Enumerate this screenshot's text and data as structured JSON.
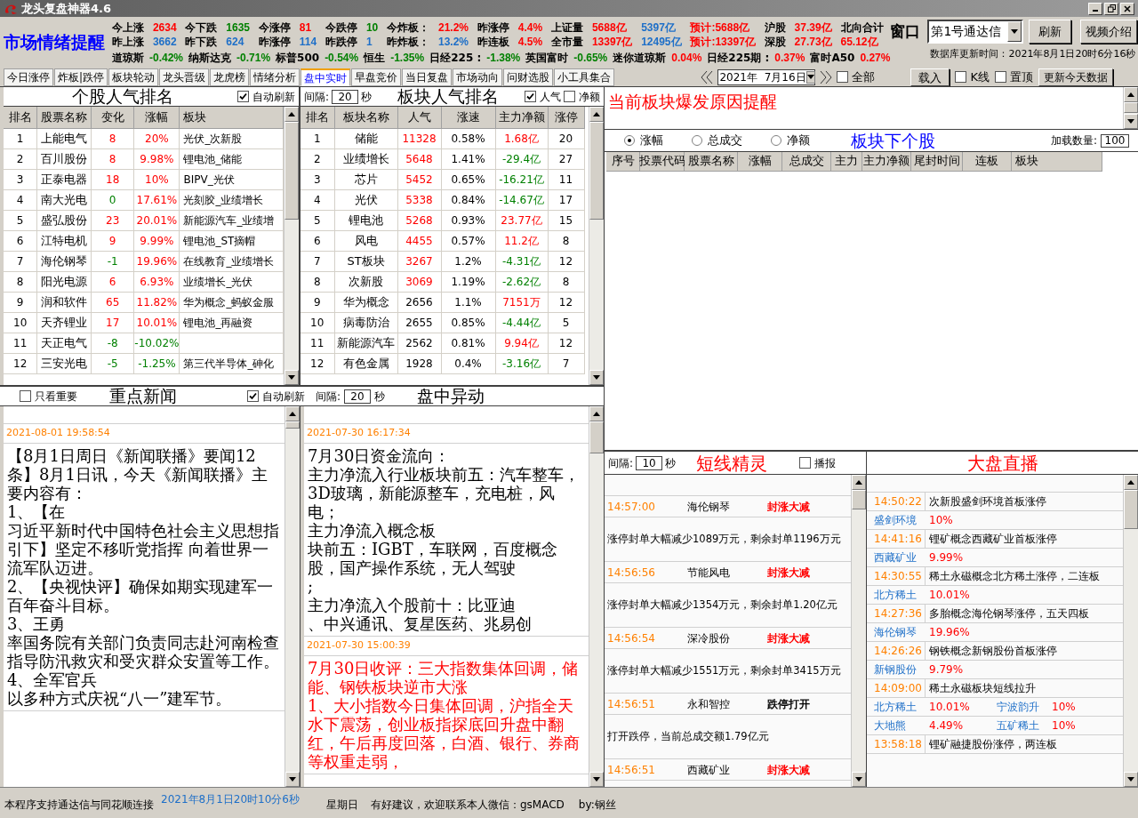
{
  "window": {
    "title": "龙头复盘神器4.6"
  },
  "header": {
    "title": "市场情绪提醒",
    "stat_rows": [
      [
        {
          "kind": "label",
          "text": "今上涨"
        },
        {
          "kind": "value",
          "text": "2634",
          "color": "#ff0000"
        },
        {
          "kind": "label",
          "text": "今下跌"
        },
        {
          "kind": "value",
          "text": "1635",
          "color": "#008000"
        },
        {
          "kind": "label",
          "text": "今涨停"
        },
        {
          "kind": "value",
          "text": "81",
          "color": "#ff0000"
        },
        {
          "kind": "label",
          "text": "今跌停"
        },
        {
          "kind": "value",
          "text": "10",
          "color": "#008000"
        },
        {
          "kind": "label",
          "text": "今炸板："
        },
        {
          "kind": "value",
          "text": "21.2%",
          "color": "#ff0000"
        },
        {
          "kind": "label",
          "text": "昨涨停"
        },
        {
          "kind": "value",
          "text": "4.4%",
          "color": "#ff0000"
        },
        {
          "kind": "label",
          "text": "上证量"
        },
        {
          "kind": "value",
          "text": "5688亿",
          "color": "#ff0000"
        },
        {
          "kind": "value",
          "text": "5397亿",
          "color": "#1e6fc8"
        },
        {
          "kind": "value",
          "text": "预计:5688亿",
          "color": "#ff0000"
        },
        {
          "kind": "label",
          "text": "沪股"
        },
        {
          "kind": "value",
          "text": "37.39亿",
          "color": "#ff0000"
        },
        {
          "kind": "label",
          "text": "北向合计"
        }
      ],
      [
        {
          "kind": "label",
          "text": "昨上涨"
        },
        {
          "kind": "value",
          "text": "3662",
          "color": "#1e6fc8"
        },
        {
          "kind": "label",
          "text": "昨下跌"
        },
        {
          "kind": "value",
          "text": "624",
          "color": "#1e6fc8"
        },
        {
          "kind": "label",
          "text": "昨涨停"
        },
        {
          "kind": "value",
          "text": "114",
          "color": "#1e6fc8"
        },
        {
          "kind": "label",
          "text": "昨跌停"
        },
        {
          "kind": "value",
          "text": "1",
          "color": "#1e6fc8"
        },
        {
          "kind": "label",
          "text": "昨炸板："
        },
        {
          "kind": "value",
          "text": "13.2%",
          "color": "#1e6fc8"
        },
        {
          "kind": "label",
          "text": "昨连板"
        },
        {
          "kind": "value",
          "text": "4.5%",
          "color": "#ff0000"
        },
        {
          "kind": "label",
          "text": "全市量"
        },
        {
          "kind": "value",
          "text": "13397亿",
          "color": "#ff0000"
        },
        {
          "kind": "value",
          "text": "12495亿",
          "color": "#1e6fc8"
        },
        {
          "kind": "value",
          "text": "预计:13397亿",
          "color": "#ff0000"
        },
        {
          "kind": "label",
          "text": "深股"
        },
        {
          "kind": "value",
          "text": "27.73亿",
          "color": "#ff0000"
        },
        {
          "kind": "value",
          "text": "65.12亿",
          "color": "#ff0000"
        }
      ]
    ],
    "indices": [
      {
        "kind": "label",
        "text": "道琼斯"
      },
      {
        "kind": "value",
        "text": "-0.42%",
        "color": "#008000"
      },
      {
        "kind": "label",
        "text": "纳斯达克"
      },
      {
        "kind": "value",
        "text": "-0.71%",
        "color": "#008000"
      },
      {
        "kind": "label",
        "text": "标普500"
      },
      {
        "kind": "value",
        "text": "-0.54%",
        "color": "#008000"
      },
      {
        "kind": "label",
        "text": "恒生"
      },
      {
        "kind": "value",
        "text": "-1.35%",
        "color": "#008000"
      },
      {
        "kind": "label",
        "text": "日经225 :"
      },
      {
        "kind": "value",
        "text": "-1.38%",
        "color": "#008000"
      },
      {
        "kind": "label",
        "text": "英国富时"
      },
      {
        "kind": "value",
        "text": "-0.65%",
        "color": "#008000"
      },
      {
        "kind": "label",
        "text": "迷你道琼斯"
      },
      {
        "kind": "value",
        "text": "0.04%",
        "color": "#ff0000"
      },
      {
        "kind": "label",
        "text": "日经225期 :"
      },
      {
        "kind": "value",
        "text": "0.37%",
        "color": "#ff0000"
      },
      {
        "kind": "label",
        "text": "富时A50"
      },
      {
        "kind": "value",
        "text": "0.27%",
        "color": "#ff0000"
      }
    ],
    "window_label": "窗口",
    "window_select": "第1号通达信",
    "buttons": [
      "刷新",
      "视频介绍"
    ],
    "db_time": "数据库更新时间：2021年8月1日20时6分16秒"
  },
  "tabs": [
    {
      "label": "今日涨停",
      "selected": false
    },
    {
      "label": "炸板|跌停",
      "selected": false
    },
    {
      "label": "板块轮动",
      "selected": false
    },
    {
      "label": "龙头晋级",
      "selected": false
    },
    {
      "label": "龙虎榜",
      "selected": false
    },
    {
      "label": "情绪分析",
      "selected": false
    },
    {
      "label": "盘中实时",
      "selected": true
    },
    {
      "label": "早盘竞价",
      "selected": false
    },
    {
      "label": "当日复盘",
      "selected": false
    },
    {
      "label": "市场动向",
      "selected": false
    },
    {
      "label": "问财选股",
      "selected": false
    },
    {
      "label": "小工具集合",
      "selected": false
    }
  ],
  "toolbar": {
    "date": "2021年  7月16日",
    "all": {
      "label": "全部",
      "checked": false
    },
    "load": "载入",
    "kline": {
      "label": "K线",
      "checked": false
    },
    "pin": {
      "label": "置顶",
      "checked": false
    },
    "update": "更新今天数据"
  },
  "stock_rank": {
    "title": "个股人气排名",
    "auto_refresh": {
      "label": "自动刷新",
      "checked": true
    },
    "columns": [
      "排名",
      "股票名称",
      "变化",
      "涨幅",
      "板块"
    ],
    "rows": [
      {
        "rank": "1",
        "name": "上能电气",
        "change": {
          "text": "8",
          "color": "#ff0000"
        },
        "pct": {
          "text": "20%",
          "color": "#ff0000"
        },
        "sector": "光伏_次新股"
      },
      {
        "rank": "2",
        "name": "百川股份",
        "change": {
          "text": "8",
          "color": "#ff0000"
        },
        "pct": {
          "text": "9.98%",
          "color": "#ff0000"
        },
        "sector": "锂电池_储能"
      },
      {
        "rank": "3",
        "name": "正泰电器",
        "change": {
          "text": "18",
          "color": "#ff0000"
        },
        "pct": {
          "text": "10%",
          "color": "#ff0000"
        },
        "sector": "BIPV_光伏"
      },
      {
        "rank": "4",
        "name": "南大光电",
        "change": {
          "text": "0",
          "color": "#008000"
        },
        "pct": {
          "text": "17.61%",
          "color": "#ff0000"
        },
        "sector": "光刻胶_业绩增长"
      },
      {
        "rank": "5",
        "name": "盛弘股份",
        "change": {
          "text": "23",
          "color": "#ff0000"
        },
        "pct": {
          "text": "20.01%",
          "color": "#ff0000"
        },
        "sector": "新能源汽车_业绩增"
      },
      {
        "rank": "6",
        "name": "江特电机",
        "change": {
          "text": "9",
          "color": "#ff0000"
        },
        "pct": {
          "text": "9.99%",
          "color": "#ff0000"
        },
        "sector": "锂电池_ST摘帽"
      },
      {
        "rank": "7",
        "name": "海伦钢琴",
        "change": {
          "text": "-1",
          "color": "#008000"
        },
        "pct": {
          "text": "19.96%",
          "color": "#ff0000"
        },
        "sector": "在线教育_业绩增长"
      },
      {
        "rank": "8",
        "name": "阳光电源",
        "change": {
          "text": "6",
          "color": "#ff0000"
        },
        "pct": {
          "text": "6.93%",
          "color": "#ff0000"
        },
        "sector": "业绩增长_光伏"
      },
      {
        "rank": "9",
        "name": "润和软件",
        "change": {
          "text": "65",
          "color": "#ff0000"
        },
        "pct": {
          "text": "11.82%",
          "color": "#ff0000"
        },
        "sector": "华为概念_蚂蚁金服"
      },
      {
        "rank": "10",
        "name": "天齐锂业",
        "change": {
          "text": "17",
          "color": "#ff0000"
        },
        "pct": {
          "text": "10.01%",
          "color": "#ff0000"
        },
        "sector": "锂电池_再融资"
      },
      {
        "rank": "11",
        "name": "天正电气",
        "change": {
          "text": "-8",
          "color": "#008000"
        },
        "pct": {
          "text": "-10.02%",
          "color": "#008000"
        }
      },
      {
        "rank": "12",
        "name": "三安光电",
        "change": {
          "text": "-5",
          "color": "#008000"
        },
        "pct": {
          "text": "-1.25%",
          "color": "#008000"
        },
        "sector": "第三代半导体_砷化"
      }
    ]
  },
  "sector_rank": {
    "interval_label": "间隔:",
    "interval": "20",
    "unit": "秒",
    "title": "板块人气排名",
    "popularity": {
      "label": "人气",
      "checked": true
    },
    "net": {
      "label": "净额",
      "checked": false
    },
    "columns": [
      "排名",
      "板块名称",
      "人气",
      "涨速",
      "主力净额",
      "涨停"
    ],
    "rows": [
      {
        "rank": "1",
        "name": "储能",
        "pop": {
          "text": "11328",
          "color": "#ff0000"
        },
        "speed": "0.58%",
        "net": {
          "text": "1.68亿",
          "color": "#ff0000"
        },
        "limit": "20"
      },
      {
        "rank": "2",
        "name": "业绩增长",
        "pop": {
          "text": "5648",
          "color": "#ff0000"
        },
        "speed": "1.41%",
        "net": {
          "text": "-29.4亿",
          "color": "#008000"
        },
        "limit": "27"
      },
      {
        "rank": "3",
        "name": "芯片",
        "pop": {
          "text": "5452",
          "color": "#ff0000"
        },
        "speed": "0.65%",
        "net": {
          "text": "-16.21亿",
          "color": "#008000"
        },
        "limit": "11"
      },
      {
        "rank": "4",
        "name": "光伏",
        "pop": {
          "text": "5338",
          "color": "#ff0000"
        },
        "speed": "0.84%",
        "net": {
          "text": "-14.67亿",
          "color": "#008000"
        },
        "limit": "17"
      },
      {
        "rank": "5",
        "name": "锂电池",
        "pop": {
          "text": "5268",
          "color": "#ff0000"
        },
        "speed": "0.93%",
        "net": {
          "text": "23.77亿",
          "color": "#ff0000"
        },
        "limit": "15"
      },
      {
        "rank": "6",
        "name": "风电",
        "pop": {
          "text": "4455",
          "color": "#ff0000"
        },
        "speed": "0.57%",
        "net": {
          "text": "11.2亿",
          "color": "#ff0000"
        },
        "limit": "8"
      },
      {
        "rank": "7",
        "name": "ST板块",
        "pop": {
          "text": "3267",
          "color": "#ff0000"
        },
        "speed": "1.2%",
        "net": {
          "text": "-4.31亿",
          "color": "#008000"
        },
        "limit": "12"
      },
      {
        "rank": "8",
        "name": "次新股",
        "pop": {
          "text": "3069",
          "color": "#ff0000"
        },
        "speed": "1.19%",
        "net": {
          "text": "-2.62亿",
          "color": "#008000"
        },
        "limit": "8"
      },
      {
        "rank": "9",
        "name": "华为概念",
        "pop": {
          "text": "2656",
          "color": "#000000"
        },
        "speed": "1.1%",
        "net": {
          "text": "7151万",
          "color": "#ff0000"
        },
        "limit": "12"
      },
      {
        "rank": "10",
        "name": "病毒防治",
        "pop": {
          "text": "2655",
          "color": "#000000"
        },
        "speed": "0.85%",
        "net": {
          "text": "-4.44亿",
          "color": "#008000"
        },
        "limit": "5"
      },
      {
        "rank": "11",
        "name": "新能源汽车",
        "pop": {
          "text": "2562",
          "color": "#000000"
        },
        "speed": "0.81%",
        "net": {
          "text": "9.94亿",
          "color": "#ff0000"
        },
        "limit": "12"
      },
      {
        "rank": "12",
        "name": "有色金属",
        "pop": {
          "text": "1928",
          "color": "#000000"
        },
        "speed": "0.4%",
        "net": {
          "text": "-3.16亿",
          "color": "#008000"
        },
        "limit": "7"
      }
    ]
  },
  "news": {
    "important_only": {
      "label": "只看重要",
      "checked": false
    },
    "title": "重点新闻",
    "auto_refresh": {
      "label": "自动刷新",
      "checked": true
    },
    "interval_label": "间隔:",
    "interval": "20",
    "unit": "秒",
    "items": [
      {
        "time": "2021-08-01 19:58:54",
        "important": false,
        "lines": [
          "【8月1日周日《新闻联播》要闻12条】8月1日讯，今天《新闻联播》主要内容有：",
          "1、【在",
          "习近平新时代中国特色社会主义思想指引下】坚定不移听党指挥 向着世界一流军队迈进。",
          "2、【央视快评】确保如期实现建军一百年奋斗目标。",
          "3、王勇",
          "率国务院有关部门负责同志赴河南检查指导防汛救灾和受灾群众安置等工作。",
          "4、全军官兵",
          "以多种方式庆祝“八一”建军节。"
        ]
      }
    ]
  },
  "moves": {
    "title": "盘中异动",
    "items": [
      {
        "time": "2021-07-30 16:17:34",
        "important": false,
        "lines": [
          "7月30日资金流向：",
          "主力净流入行业板块前五：汽车整车，3D玻璃，新能源整车，充电桩，风电；",
          "主力净流入概念板",
          "块前五：IGBT，车联网，百度概念股，国产操作系统，无人驾驶",
          ";",
          "主力净流入个股前十：比亚迪",
          "、中兴通讯、复星医药、兆易创"
        ]
      },
      {
        "time": "2021-07-30 15:00:39",
        "important": true,
        "lines": [
          "7月30日收评：三大指数集体回调，储能、钢铁板块逆市大涨",
          "1、大小指数今日集体回调，沪指全天水下震荡，创业板指探底回升盘中翻红，午后再度回落，白酒、银行、券商等权重走弱，"
        ]
      }
    ]
  },
  "sector_reason": {
    "title": "当前板块爆发原因提醒"
  },
  "sector_stocks": {
    "sort": [
      {
        "label": "涨幅",
        "selected": true
      },
      {
        "label": "总成交",
        "selected": false
      },
      {
        "label": "净额",
        "selected": false
      }
    ],
    "title": "板块下个股",
    "load_label": "加载数量:",
    "load_count": "100",
    "columns": [
      "序号",
      "投票代码",
      "股票名称",
      "涨幅",
      "总成交",
      "主力",
      "主力净额",
      "尾封时间",
      "连板",
      "板块"
    ]
  },
  "sprite": {
    "interval_label": "间隔:",
    "interval": "10",
    "unit": "秒",
    "title": "短线精灵",
    "broadcast": {
      "label": "播报",
      "checked": false
    },
    "items": [
      {
        "time": "14:57:00",
        "name": "海伦钢琴",
        "event": "封涨大减",
        "color": "#ff0000",
        "detail": "涨停封单大幅减少1089万元，剩余封单1196万元"
      },
      {
        "time": "14:56:56",
        "name": "节能风电",
        "event": "封涨大减",
        "color": "#ff0000",
        "detail": "涨停封单大幅减少1354万元，剩余封单1.20亿元"
      },
      {
        "time": "14:56:54",
        "name": "深冷股份",
        "event": "封涨大减",
        "color": "#ff0000",
        "detail": "涨停封单大幅减少1551万元，剩余封单3415万元"
      },
      {
        "time": "14:56:51",
        "name": "永和智控",
        "event": "跌停打开",
        "color": "#000000",
        "detail": "打开跌停，当前总成交额1.79亿元"
      },
      {
        "time": "14:56:51",
        "name": "西藏矿业",
        "event": "封涨大减",
        "color": "#ff0000"
      }
    ]
  },
  "live": {
    "title": "大盘直播",
    "items": [
      {
        "time": "14:50:22",
        "text": "次新股盛剑环境首板涨停",
        "stocks": [
          [
            {
              "name": "盛剑环境",
              "pct": "10%"
            }
          ]
        ]
      },
      {
        "time": "14:41:16",
        "text": "锂矿概念西藏矿业首板涨停",
        "stocks": [
          [
            {
              "name": "西藏矿业",
              "pct": "9.99%"
            }
          ]
        ]
      },
      {
        "time": "14:30:55",
        "text": "稀土永磁概念北方稀土涨停，二连板",
        "stocks": [
          [
            {
              "name": "北方稀土",
              "pct": "10.01%"
            }
          ]
        ]
      },
      {
        "time": "14:27:36",
        "text": "多胎概念海伦钢琴涨停，五天四板",
        "stocks": [
          [
            {
              "name": "海伦钢琴",
              "pct": "19.96%"
            }
          ]
        ]
      },
      {
        "time": "14:26:26",
        "text": "钢铁概念新钢股份首板涨停",
        "stocks": [
          [
            {
              "name": "新钢股份",
              "pct": "9.79%"
            }
          ]
        ]
      },
      {
        "time": "14:09:00",
        "text": "稀土永磁板块短线拉升",
        "stocks": [
          [
            {
              "name": "北方稀土",
              "pct": "10.01%"
            },
            {
              "name": "宁波韵升",
              "pct": "10%"
            }
          ],
          [
            {
              "name": "大地熊",
              "pct": "4.49%"
            },
            {
              "name": "五矿稀土",
              "pct": "10%"
            }
          ]
        ]
      },
      {
        "time": "13:58:18",
        "text": "锂矿融捷股份涨停，两连板"
      }
    ]
  },
  "status_bar": {
    "connect": "本程序支持通达信与同花顺连接",
    "clock": "2021年8月1日20时10分6秒",
    "weekday": "星期日",
    "contact": "有好建议，欢迎联系本人微信：gsMACD",
    "author": "by:钢丝"
  }
}
